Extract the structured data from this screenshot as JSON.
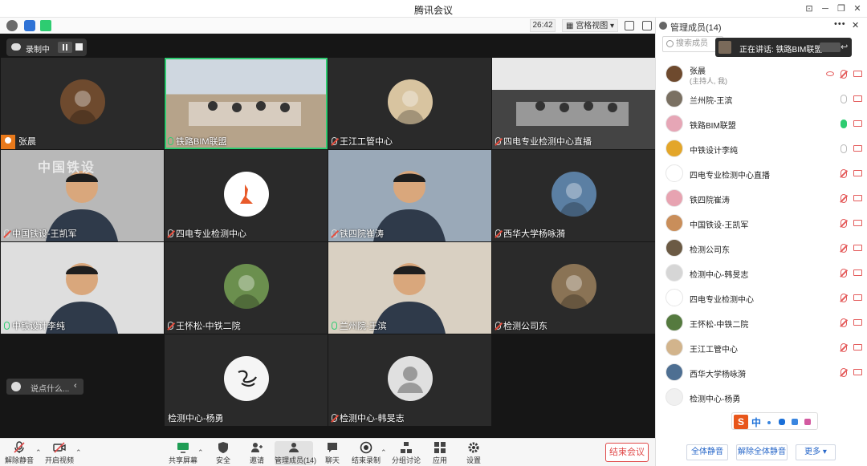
{
  "window": {
    "title": "腾讯会议"
  },
  "statusbar": {
    "timer": "26:42",
    "view_label": "宫格视图"
  },
  "recording": {
    "label": "录制中"
  },
  "chat_input": {
    "placeholder": "说点什么..."
  },
  "tiles": [
    {
      "name": "张晨",
      "mic": "none",
      "host": true,
      "kind": "avatar",
      "bg": "#6e4a2e"
    },
    {
      "name": "铁路BIM联盟",
      "mic": "on",
      "kind": "room",
      "active": true
    },
    {
      "name": "王江工管中心",
      "mic": "off",
      "kind": "avatar",
      "bg": "#d8c4a0"
    },
    {
      "name": "四电专业检测中心直播",
      "mic": "off",
      "kind": "room2"
    },
    {
      "name": "中国铁设-王凯军",
      "mic": "off",
      "kind": "person",
      "bg": "#b8b8b8",
      "banner": "中国铁设"
    },
    {
      "name": "四电专业检测中心",
      "mic": "off",
      "kind": "avatar",
      "bg": "#ffffff"
    },
    {
      "name": "铁四院崔涛",
      "mic": "off",
      "kind": "person2",
      "bg": "#9aa9b8"
    },
    {
      "name": "西华大学杨咏漪",
      "mic": "off",
      "kind": "avatar",
      "bg": "#5b7fa3"
    },
    {
      "name": "中铁设计李纯",
      "mic": "on",
      "kind": "person3",
      "bg": "#dedede"
    },
    {
      "name": "王怀松-中铁二院",
      "mic": "off",
      "kind": "avatar",
      "bg": "#6b8f4e"
    },
    {
      "name": "兰州院-王滨",
      "mic": "on",
      "kind": "person4",
      "bg": "#d9d0c2"
    },
    {
      "name": "检测公司东",
      "mic": "off",
      "kind": "avatar",
      "bg": "#8a7355"
    },
    {
      "name": "检测中心-杨勇",
      "mic": "none",
      "kind": "calli",
      "bg": "#f5f5f5"
    },
    {
      "name": "检测中心-韩旻志",
      "mic": "off",
      "kind": "default",
      "bg": "#e0e0e0"
    }
  ],
  "toolbar": {
    "mute": "解除静音",
    "video": "开启视频",
    "share": "共享屏幕",
    "security": "安全",
    "invite": "邀请",
    "members": "管理成员(14)",
    "chat": "聊天",
    "record": "结束录制",
    "breakout": "分组讨论",
    "apps": "应用",
    "settings": "设置",
    "end": "结束会议"
  },
  "panel": {
    "title": "管理成员(14)",
    "search_placeholder": "搜索成员",
    "speaking": "正在讲话: 铁路BIM联盟",
    "members": [
      {
        "name": "张晨",
        "sub": "(主持人, 我)",
        "mic": "off",
        "eye": true,
        "bg": "#6e4a2e"
      },
      {
        "name": "兰州院-王滨",
        "mic": "idle",
        "bg": "#7a7062"
      },
      {
        "name": "铁路BIM联盟",
        "mic": "on",
        "bg": "#e6a6b6"
      },
      {
        "name": "中铁设计李纯",
        "mic": "idle",
        "bg": "#e3a62a"
      },
      {
        "name": "四电专业检测中心直播",
        "mic": "off",
        "bg": "#ffffff"
      },
      {
        "name": "铁四院崔涛",
        "mic": "off",
        "bg": "#e7a3b1"
      },
      {
        "name": "中国铁设-王凯军",
        "mic": "off",
        "bg": "#c98e5a"
      },
      {
        "name": "检测公司东",
        "mic": "off",
        "bg": "#6b5a44"
      },
      {
        "name": "检测中心-韩旻志",
        "mic": "off",
        "bg": "#d6d6d6"
      },
      {
        "name": "四电专业检测中心",
        "mic": "off",
        "bg": "#ffffff"
      },
      {
        "name": "王怀松-中铁二院",
        "mic": "off",
        "bg": "#557a3f"
      },
      {
        "name": "王江工管中心",
        "mic": "off",
        "bg": "#d2b48c"
      },
      {
        "name": "西华大学杨咏漪",
        "mic": "off",
        "bg": "#4e6f92"
      },
      {
        "name": "检测中心-杨勇",
        "mic": "none",
        "bg": "#f0f0f0"
      }
    ],
    "ime": {
      "mode": "中"
    },
    "buttons": {
      "mute_all": "全体静音",
      "unmute_all": "解除全体静音",
      "more": "更多 ▾"
    }
  }
}
